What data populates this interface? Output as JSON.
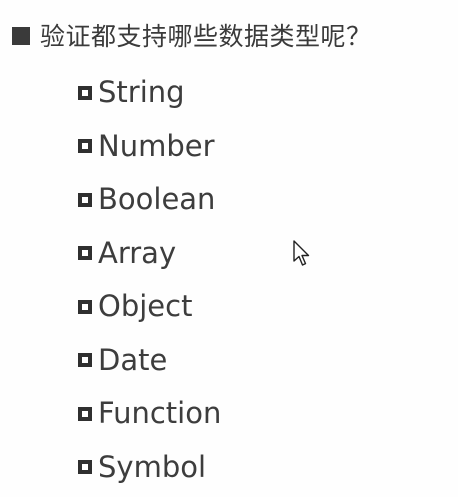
{
  "heading": {
    "text": "验证都支持哪些数据类型呢？",
    "bullet_icon": "filled-square-icon"
  },
  "types": [
    {
      "label": "String"
    },
    {
      "label": "Number"
    },
    {
      "label": "Boolean"
    },
    {
      "label": "Array"
    },
    {
      "label": "Object"
    },
    {
      "label": "Date"
    },
    {
      "label": "Function"
    },
    {
      "label": "Symbol"
    }
  ],
  "item_bullet_icon": "hollow-square-icon",
  "cursor_icon": "mouse-pointer-icon",
  "colors": {
    "text": "#3a3a3a",
    "background": "#ffffff"
  }
}
